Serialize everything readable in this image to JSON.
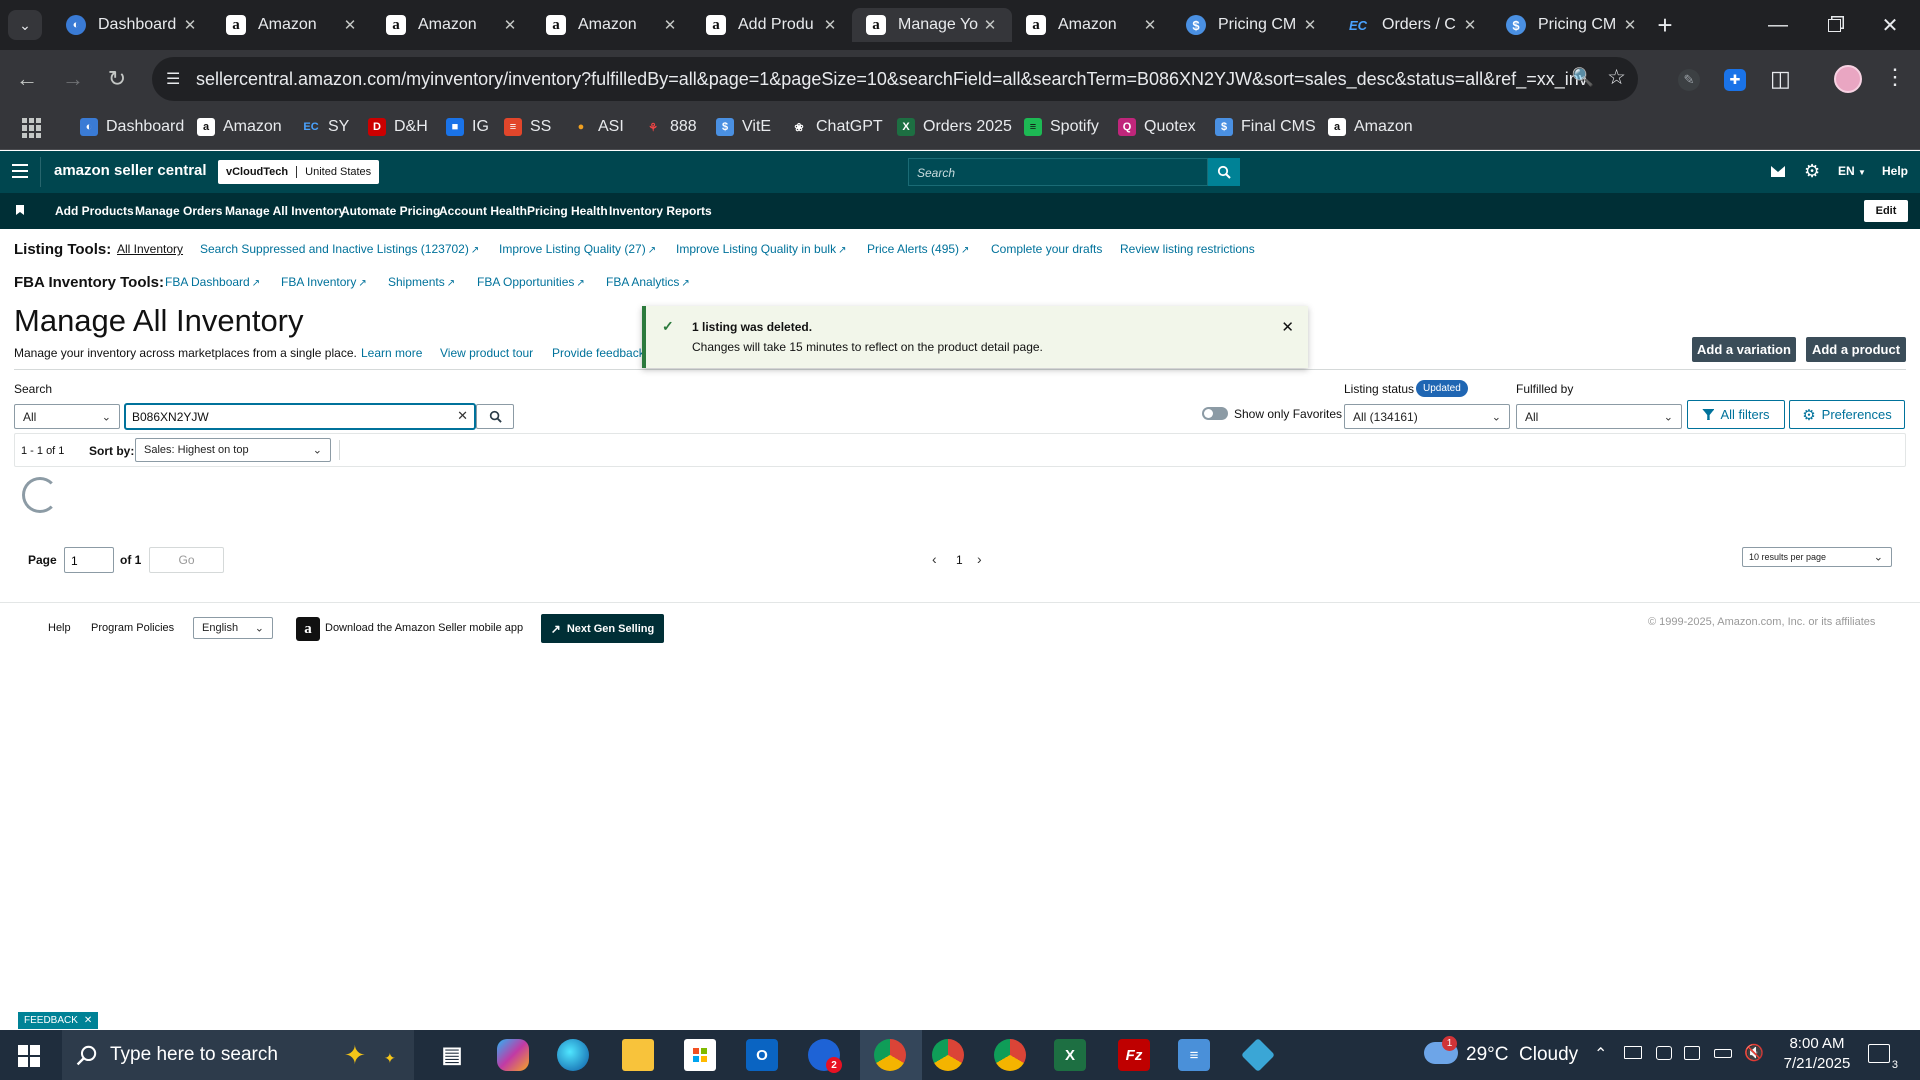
{
  "browser": {
    "tabs": [
      {
        "title": "Dashboard",
        "icon": "dash"
      },
      {
        "title": "Amazon",
        "icon": "amz"
      },
      {
        "title": "Amazon",
        "icon": "amz"
      },
      {
        "title": "Amazon",
        "icon": "amz"
      },
      {
        "title": "Add Produ",
        "icon": "amz"
      },
      {
        "title": "Manage Yo",
        "icon": "amz",
        "active": true
      },
      {
        "title": "Amazon",
        "icon": "amz"
      },
      {
        "title": "Pricing CM",
        "icon": "dollar"
      },
      {
        "title": "Orders / C",
        "icon": "ec"
      },
      {
        "title": "Pricing CM",
        "icon": "dollar"
      }
    ],
    "url": "sellercentral.amazon.com/myinventory/inventory?fulfilledBy=all&page=1&pageSize=10&searchField=all&searchTerm=B086XN2YJW&sort=sales_desc&status=all&ref_=xx_inv...",
    "bookmarks": [
      "Dashboard",
      "Amazon",
      "SY",
      "D&H",
      "IG",
      "SS",
      "ASI",
      "888",
      "VitE",
      "ChatGPT",
      "Orders 2025",
      "Spotify",
      "Quotex",
      "Final CMS",
      "Amazon"
    ]
  },
  "header": {
    "logo_text": "amazon seller central",
    "store_name": "vCloudTech",
    "marketplace": "United States",
    "search_placeholder": "Search",
    "language": "EN",
    "help": "Help"
  },
  "nav": {
    "items": [
      "Add Products",
      "Manage Orders",
      "Manage All Inventory",
      "Automate Pricing",
      "Account Health",
      "Pricing Health",
      "Inventory Reports"
    ],
    "edit": "Edit"
  },
  "listing_tools": {
    "label": "Listing Tools:",
    "links": [
      "All Inventory",
      "Search Suppressed and Inactive Listings (123702)",
      "Improve Listing Quality (27)",
      "Improve Listing Quality in bulk",
      "Price Alerts (495)",
      "Complete your drafts",
      "Review listing restrictions"
    ]
  },
  "fba_tools": {
    "label": "FBA Inventory Tools:",
    "links": [
      "FBA Dashboard",
      "FBA Inventory",
      "Shipments",
      "FBA Opportunities",
      "FBA Analytics"
    ]
  },
  "page": {
    "title": "Manage All Inventory",
    "subtitle": "Manage your inventory across marketplaces from a single place.",
    "learn_more": "Learn more",
    "product_tour": "View product tour",
    "feedback": "Provide feedback",
    "add_variation": "Add a variation",
    "add_product": "Add a product"
  },
  "toast": {
    "title": "1 listing was deleted.",
    "message": "Changes will take 15 minutes to reflect on the product detail page."
  },
  "search": {
    "label": "Search",
    "field_value": "All",
    "term": "B086XN2YJW"
  },
  "filters": {
    "favorites_label": "Show only Favorites",
    "listing_status_label": "Listing status",
    "listing_status_badge": "Updated",
    "listing_status_value": "All (134161)",
    "fulfilled_by_label": "Fulfilled by",
    "fulfilled_by_value": "All",
    "all_filters": "All filters",
    "preferences": "Preferences"
  },
  "results": {
    "count": "1 - 1 of 1",
    "sort_label": "Sort by:",
    "sort_value": "Sales: Highest on top"
  },
  "pagination": {
    "page_label": "Page",
    "page_value": "1",
    "of_label": "of 1",
    "go": "Go",
    "current": "1",
    "per_page": "10 results per page"
  },
  "footer": {
    "help": "Help",
    "program_policies": "Program Policies",
    "language": "English",
    "mobile_app": "Download the Amazon Seller mobile app",
    "next_gen": "Next Gen Selling",
    "copyright": "© 1999-2025, Amazon.com, Inc. or its affiliates"
  },
  "feedback_tab": "FEEDBACK",
  "taskbar": {
    "search_placeholder": "Type here to search",
    "weather": "29°C  Cloudy",
    "weather_badge": "1",
    "time": "8:00 AM",
    "date": "7/21/2025",
    "notification_count": "3",
    "outlook_badge": "2"
  }
}
